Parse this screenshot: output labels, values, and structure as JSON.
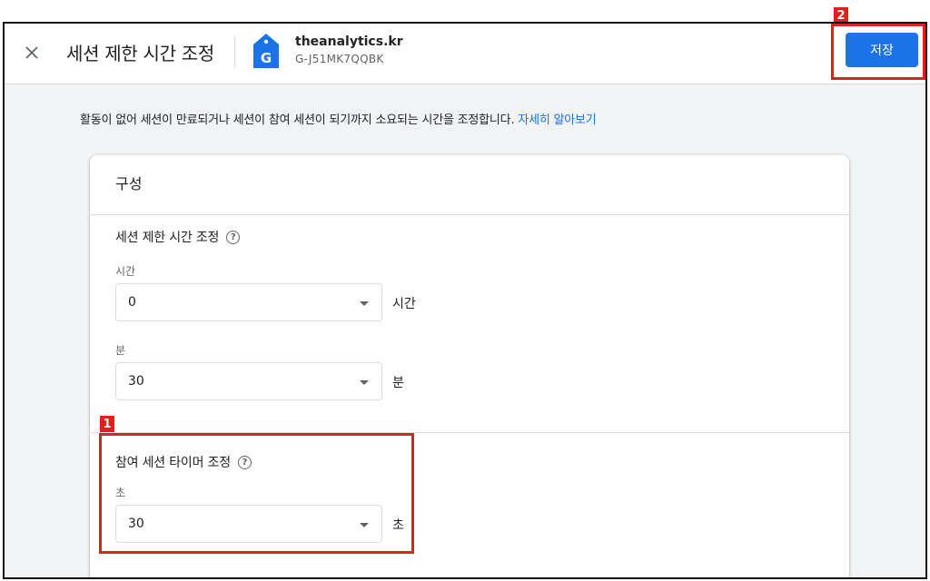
{
  "header": {
    "title": "세션 제한 시간 조정",
    "property_name": "theanalytics.kr",
    "property_id": "G-J51MK7QQBK",
    "save_label": "저장"
  },
  "description": {
    "text": "활동이 없어 세션이 만료되거나 세션이 참여 세션이 되기까지 소요되는 시간을 조정합니다. ",
    "link": "자세히 알아보기"
  },
  "card": {
    "title": "구성",
    "session_timeout": {
      "title": "세션 제한 시간 조정",
      "hours": {
        "label": "시간",
        "value": "0",
        "unit": "시간"
      },
      "minutes": {
        "label": "분",
        "value": "30",
        "unit": "분"
      }
    },
    "engaged_timer": {
      "title": "참여 세션 타이머 조정",
      "seconds": {
        "label": "초",
        "value": "30",
        "unit": "초"
      }
    }
  },
  "annotations": {
    "badge1": "1",
    "badge2": "2"
  },
  "colors": {
    "accent": "#1a73e8",
    "highlight": "#e0201b"
  },
  "icons": {
    "close": "close-icon",
    "property": "analytics-tag-icon",
    "help": "help-icon",
    "dropdown": "dropdown-caret-icon"
  }
}
